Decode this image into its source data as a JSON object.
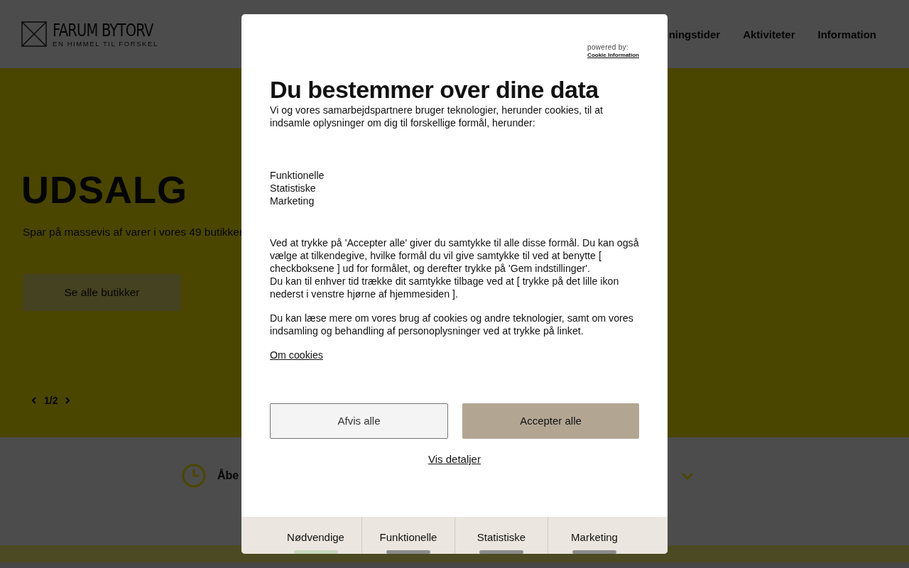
{
  "header": {
    "logo_title": "FARUM BYTORV",
    "logo_tagline": "EN HIMMEL TIL FORSKEL",
    "nav": [
      "ningstider",
      "Aktiviteter",
      "Information"
    ]
  },
  "hero": {
    "title": "UDSALG",
    "text": "Spar på massevis af varer i vores 49 butikker",
    "button": "Se alle butikker",
    "pager": "1/2"
  },
  "hours": {
    "label": "Åbe"
  },
  "consent": {
    "powered_by": "powered by:",
    "provider": "Cookie Information",
    "title": "Du bestemmer over dine data",
    "intro": "Vi og vores samarbejdspartnere bruger teknologier, herunder cookies, til at indsamle oplysninger om dig til forskellige formål, herunder:",
    "purposes": [
      "Funktionelle",
      "Statistiske",
      "Marketing"
    ],
    "paragraphs": [
      "Ved at trykke på 'Accepter alle' giver du samtykke til alle disse formål. Du kan også vælge at tilkendegive, hvilke formål du vil give samtykke til ved at benytte [ checkboksene ] ud for formålet, og derefter trykke på 'Gem indstillinger'.",
      "Du kan til enhver tid trække dit samtykke tilbage ved at [ trykke på det lille ikon nederst i venstre hjørne af hjemmesiden ].",
      "Du kan læse mere om vores brug af cookies og andre teknologier, samt om vores indsamling og behandling af personoplysninger ved at trykke på linket."
    ],
    "link": "Om cookies",
    "reject": "Afvis alle",
    "accept": "Accepter alle",
    "details": "Vis detaljer",
    "categories": [
      {
        "label": "Nødvendige",
        "checked": true
      },
      {
        "label": "Funktionelle",
        "checked": false
      },
      {
        "label": "Statistiske",
        "checked": false
      },
      {
        "label": "Marketing",
        "checked": false
      }
    ]
  }
}
